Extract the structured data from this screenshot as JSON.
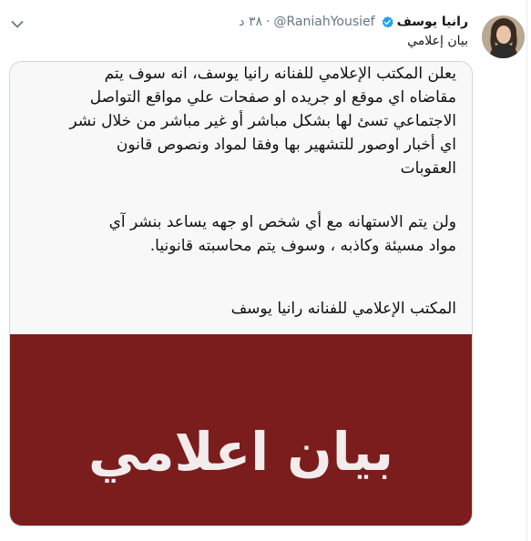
{
  "tweet": {
    "display_name": "رانيا يوسف",
    "handle": "@RaniahYousief",
    "time": "٣٨ د",
    "subtitle": "بيان إعلامي"
  },
  "image": {
    "paragraph1": [
      "يعلن المكتب الإعلامي للفنانه رانيا يوسف، انه سوف يتم",
      "مقاضاه اي موقع او جريده او صفحات علي مواقع التواصل",
      "الاجتماعي تسئ لها بشكل مباشر أو غير مباشر من خلال نشر",
      "اي أخبار اوصور للتشهير بها وفقا لمواد ونصوص  قانون",
      "العقوبات"
    ],
    "paragraph2": [
      "ولن يتم الاستهانه مع أي شخص  او جهه يساعد بنشر آي",
      "مواد مسيئة وكاذبه ، وسوف يتم محاسبته قانونيا."
    ],
    "paragraph3": [
      "المكتب الإعلامي للفنانه رانيا يوسف"
    ],
    "banner_text": "بيان اعلامي",
    "banner_color": "#7a1d1c"
  },
  "icons": {
    "verified": "verified-badge-icon",
    "caret": "chevron-down-icon",
    "avatar": "profile-photo"
  },
  "colors": {
    "verified_blue": "#1da1f2",
    "secondary_text": "#657786"
  }
}
